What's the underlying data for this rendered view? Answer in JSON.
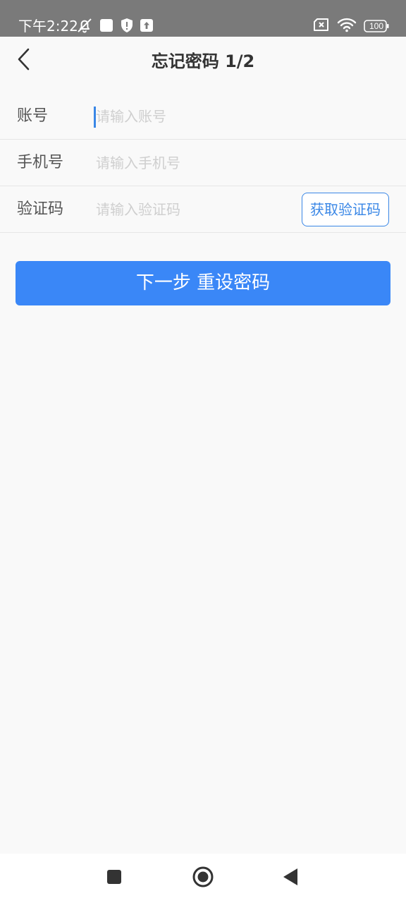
{
  "status_bar": {
    "time": "下午2:22",
    "battery": "100",
    "icons": [
      "bell-off-icon",
      "square-icon",
      "shield-icon",
      "upload-icon",
      "sim-x-icon",
      "wifi-icon",
      "battery-icon"
    ]
  },
  "header": {
    "title": "忘记密码 1/2",
    "back_icon": "chevron-left-icon"
  },
  "form": {
    "account": {
      "label": "账号",
      "placeholder": "请输入账号",
      "value": ""
    },
    "phone": {
      "label": "手机号",
      "placeholder": "请输入手机号",
      "value": ""
    },
    "code": {
      "label": "验证码",
      "placeholder": "请输入验证码",
      "value": "",
      "button_label": "获取验证码"
    }
  },
  "next_button": {
    "label": "下一步 重设密码"
  },
  "nav_bar": {
    "icons": [
      "recents-square-icon",
      "home-circle-icon",
      "back-triangle-icon"
    ]
  },
  "colors": {
    "accent": "#3a87f7",
    "status_bar_bg": "#7a7a7a",
    "page_bg": "#f9f9f9"
  }
}
